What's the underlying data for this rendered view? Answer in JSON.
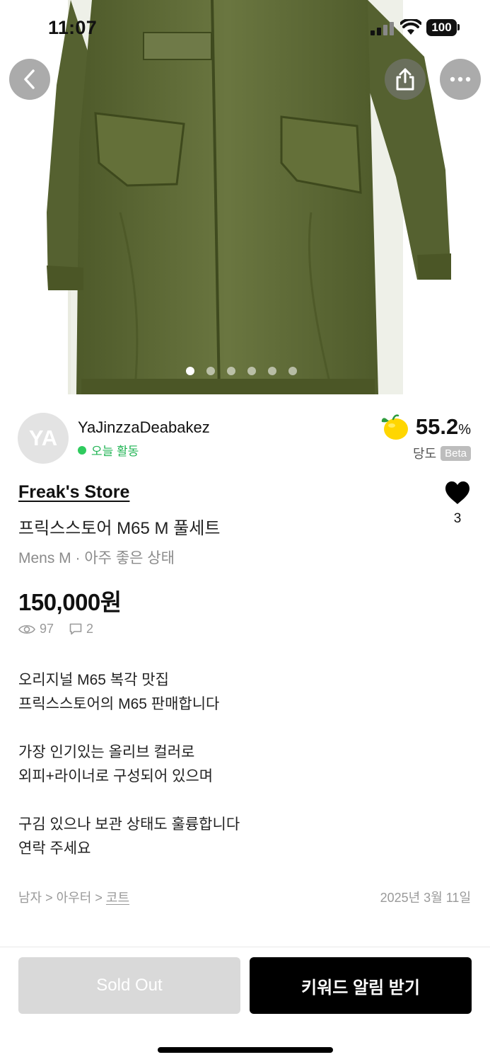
{
  "status_bar": {
    "time": "11:07",
    "battery": "100"
  },
  "hero": {
    "image": "olive-green-m65-parka-photo",
    "carousel": {
      "total": 6,
      "active_index": 0
    }
  },
  "nav": {
    "back_icon": "chevron-left-icon",
    "share_icon": "share-icon",
    "more_icon": "more-horizontal-icon"
  },
  "seller": {
    "avatar_initials": "YA",
    "name": "YaJinzzaDeabakez",
    "activity": "오늘 활동",
    "rating_value": "55.2",
    "rating_unit": "%",
    "rating_label": "당도",
    "rating_badge": "Beta",
    "rating_icon": "lemon-icon"
  },
  "product": {
    "store": "Freak's Store",
    "title": "프릭스스토어 M65 M 풀세트",
    "meta": "Mens M · 아주 좋은 상태",
    "likes": "3",
    "price": "150,000원",
    "views": "97",
    "comments": "2",
    "description": [
      "오리지널 M65 복각 맛집",
      "프릭스스토어의 M65 판매합니다",
      "",
      "가장 인기있는 올리브 컬러로",
      "외피+라이너로 구성되어 있으며",
      "",
      "구김 있으나 보관 상태도 훌륭합니다",
      "연락 주세요"
    ],
    "breadcrumb": [
      "남자",
      "아우터",
      "코트"
    ],
    "breadcrumb_sep": ">",
    "date": "2025년 3월 11일"
  },
  "actions": {
    "sold_out": "Sold Out",
    "keyword_alert": "키워드 알림 받기"
  },
  "colors": {
    "activity_green": "#22b455",
    "sold_out_bg": "#d9d9d9",
    "primary_bg": "#000000",
    "coat_olive": "#5f6a35"
  }
}
